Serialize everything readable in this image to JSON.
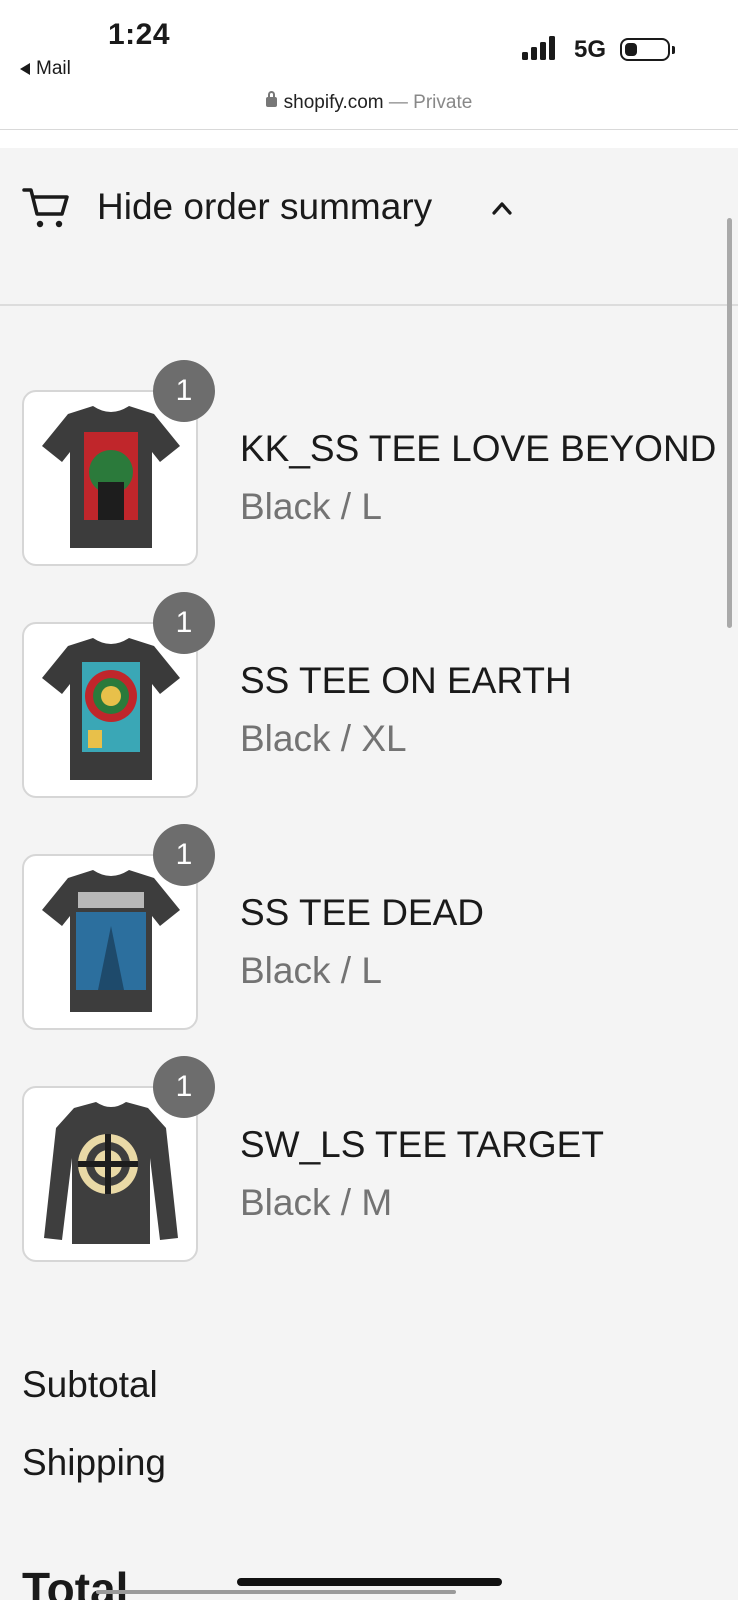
{
  "status_bar": {
    "time": "1:24",
    "back_app": "Mail",
    "network": "5G",
    "url": "shopify.com",
    "url_suffix": "— Private"
  },
  "summary": {
    "toggle_label": "Hide order summary",
    "icon": "cart-icon",
    "chevron": "chevron-up-icon"
  },
  "items": [
    {
      "title": "KK_SS TEE LOVE BEYOND",
      "variant": "Black / L",
      "quantity": "1",
      "image_icon": "tshirt-icon"
    },
    {
      "title": "SS TEE ON EARTH",
      "variant": "Black / XL",
      "quantity": "1",
      "image_icon": "tshirt-icon"
    },
    {
      "title": "SS TEE DEAD",
      "variant": "Black / L",
      "quantity": "1",
      "image_icon": "tshirt-icon"
    },
    {
      "title": "SW_LS TEE TARGET",
      "variant": "Black / M",
      "quantity": "1",
      "image_icon": "longsleeve-icon"
    }
  ],
  "totals": {
    "subtotal_label": "Subtotal",
    "shipping_label": "Shipping",
    "total_label": "Total"
  },
  "colors": {
    "background": "#f4f4f4",
    "badge": "#6d6d6d",
    "variant_text": "#737373"
  }
}
